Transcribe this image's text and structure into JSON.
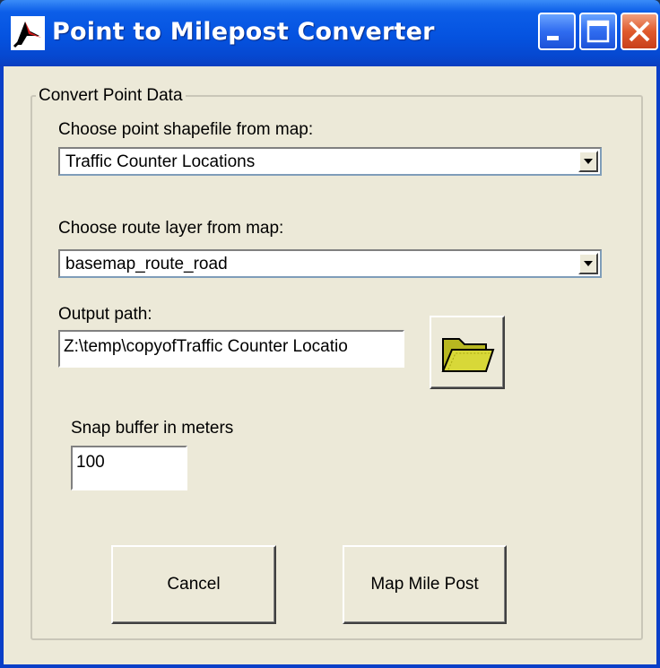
{
  "window": {
    "title": "Point to Milepost Converter",
    "icons": {
      "app": "arrow-cursor-icon",
      "minimize": "minimize-icon",
      "maximize": "maximize-icon",
      "close": "close-icon"
    }
  },
  "group": {
    "legend": "Convert Point Data",
    "shapefile": {
      "label": "Choose point shapefile from map:",
      "value": "Traffic Counter Locations"
    },
    "route": {
      "label": "Choose route layer from map:",
      "value": "basemap_route_road"
    },
    "output": {
      "label": "Output path:",
      "value": "Z:\\temp\\copyofTraffic Counter Locatio",
      "browse_icon": "folder-icon"
    },
    "buffer": {
      "label": "Snap buffer in meters",
      "value": "100"
    }
  },
  "buttons": {
    "cancel": "Cancel",
    "map": "Map Mile Post"
  },
  "colors": {
    "titlebar": "#0553e0",
    "client": "#ece9d8",
    "close": "#e05a2c"
  }
}
